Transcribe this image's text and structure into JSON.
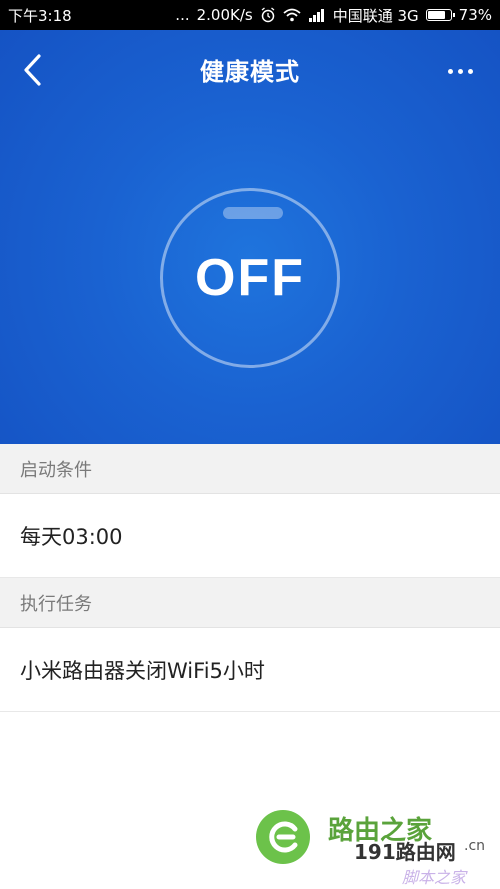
{
  "status_bar": {
    "time": "下午3:18",
    "signal_dots": "...",
    "speed": "2.00K/s",
    "carrier": "中国联通 3G",
    "battery_percent": "73%",
    "battery_level": 0.73
  },
  "header": {
    "back_icon": "chevron-left-icon",
    "title": "健康模式",
    "more_icon": "more-horizontal-icon"
  },
  "toggle": {
    "state_label": "OFF"
  },
  "sections": {
    "trigger_header": "启动条件",
    "trigger_value": "每天03:00",
    "task_header": "执行任务",
    "task_value": "小米路由器关闭WiFi5小时"
  },
  "watermark": {
    "title": "路由之家",
    "brand": "191路由网",
    "domain": ".cn",
    "sub": "脚本之家"
  },
  "colors": {
    "hero_blue": "#1a62d1",
    "section_bg": "#f2f2f2",
    "watermark_green": "#6cc24a"
  }
}
